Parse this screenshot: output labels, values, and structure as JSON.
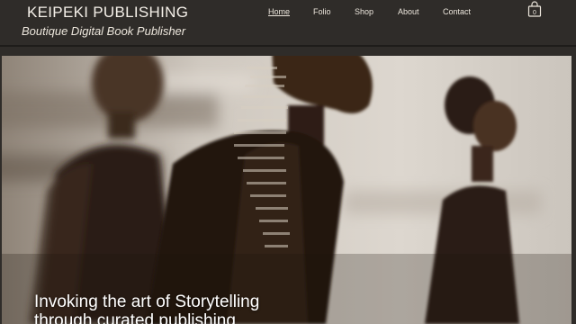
{
  "brand": {
    "title": "KEIPEKI PUBLISHING",
    "tagline": "Boutique Digital Book Publisher"
  },
  "nav": {
    "items": [
      {
        "label": "Home",
        "active": true
      },
      {
        "label": "Folio",
        "active": false
      },
      {
        "label": "Shop",
        "active": false
      },
      {
        "label": "About",
        "active": false
      },
      {
        "label": "Contact",
        "active": false
      }
    ]
  },
  "cart": {
    "count": "0",
    "icon": "shopping-bag-icon"
  },
  "hero": {
    "heading_line1": "Invoking the art of Storytelling",
    "heading_line2": "through curated publishing"
  },
  "colors": {
    "header_bg": "#2f2c29",
    "header_text": "#ece6dc",
    "hero_bg": "#c8c1b8"
  }
}
